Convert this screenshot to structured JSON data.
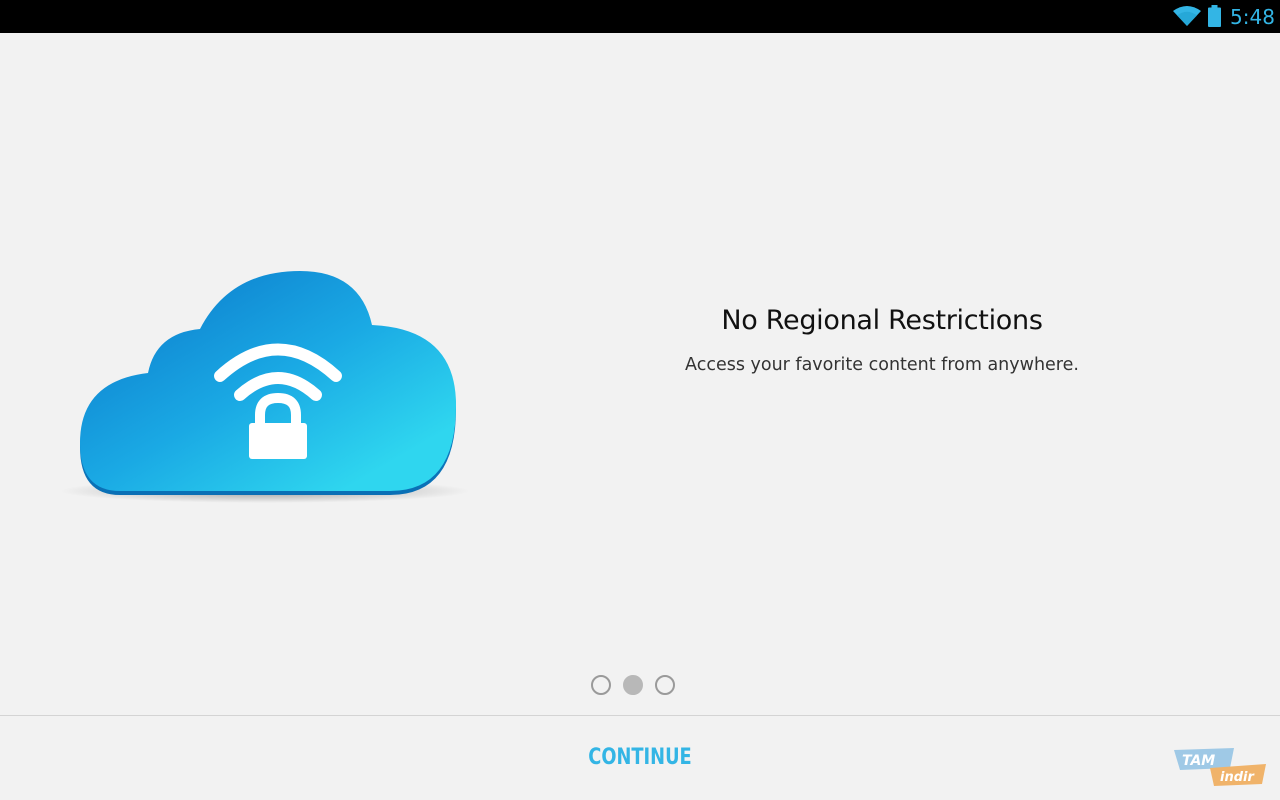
{
  "status_bar": {
    "time": "5:48",
    "icons": [
      "wifi-icon",
      "battery-icon"
    ],
    "accent_color": "#33b5e5"
  },
  "slide": {
    "illustration": "cloud-lock-wifi-icon",
    "title": "No Regional Restrictions",
    "subtitle": "Access your favorite content from anywhere."
  },
  "pager": {
    "count": 3,
    "active_index": 1
  },
  "footer": {
    "continue_label": "CONTINUE"
  },
  "watermark": {
    "text_top": "TAM",
    "text_bottom": "indir"
  },
  "colors": {
    "background": "#f2f2f2",
    "accent": "#33b5e5",
    "cloud_light": "#2fd3ee",
    "cloud_dark": "#0a82cf"
  }
}
